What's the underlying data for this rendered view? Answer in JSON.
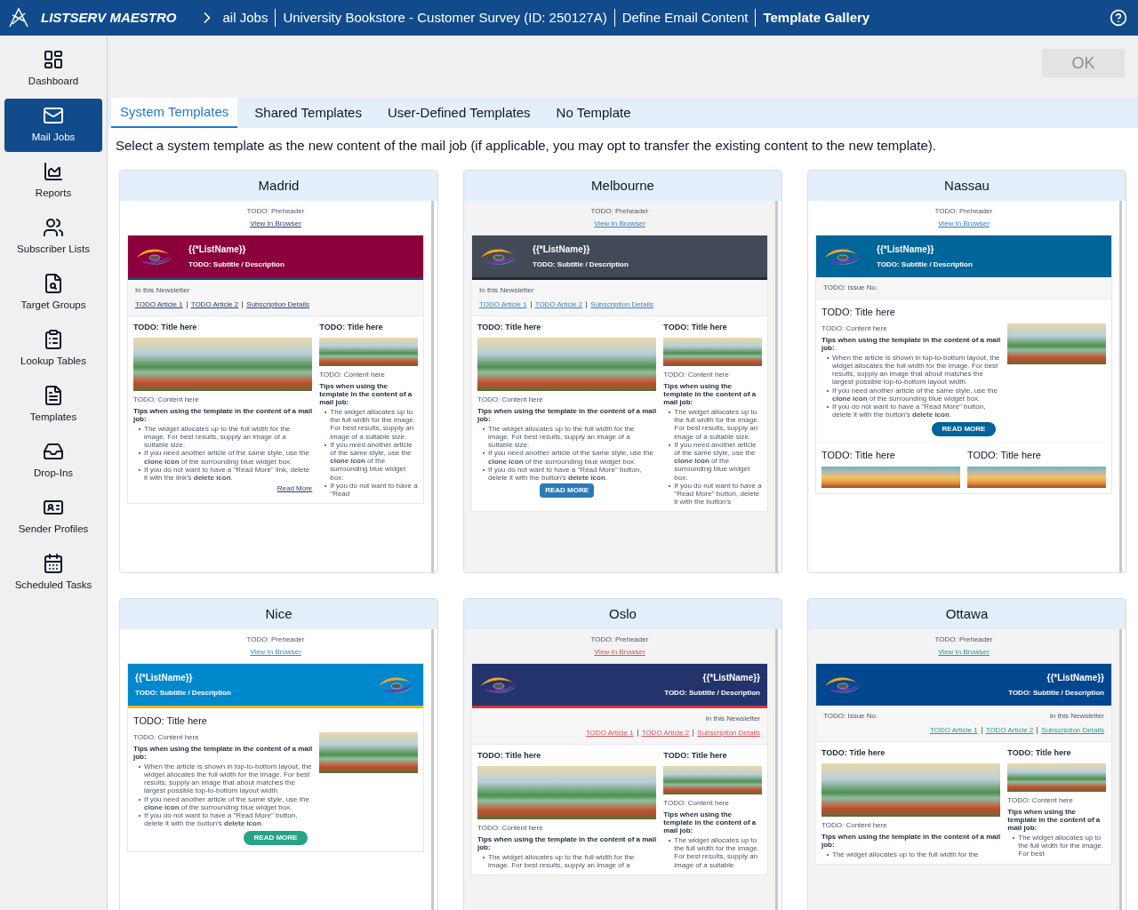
{
  "app": {
    "title": "LISTSERV MAESTRO"
  },
  "breadcrumb": [
    {
      "label": "ail Jobs",
      "current": false
    },
    {
      "label": "University Bookstore - Customer Survey (ID: 250127A)",
      "current": false
    },
    {
      "label": "Define Email Content",
      "current": false
    },
    {
      "label": "Template Gallery",
      "current": true
    }
  ],
  "sidebar": {
    "items": [
      {
        "label": "Dashboard",
        "selected": false
      },
      {
        "label": "Mail Jobs",
        "selected": true
      },
      {
        "label": "Reports",
        "selected": false
      },
      {
        "label": "Subscriber Lists",
        "selected": false
      },
      {
        "label": "Target Groups",
        "selected": false
      },
      {
        "label": "Lookup Tables",
        "selected": false
      },
      {
        "label": "Templates",
        "selected": false
      },
      {
        "label": "Drop-Ins",
        "selected": false
      },
      {
        "label": "Sender Profiles",
        "selected": false
      },
      {
        "label": "Scheduled Tasks",
        "selected": false
      }
    ]
  },
  "ok_button": {
    "label": "OK",
    "disabled": true
  },
  "tabs": [
    {
      "label": "System Templates",
      "selected": true
    },
    {
      "label": "Shared Templates",
      "selected": false
    },
    {
      "label": "User-Defined Templates",
      "selected": false
    },
    {
      "label": "No Template",
      "selected": false
    }
  ],
  "description": "Select a system template as the new content of the mail job (if applicable, you may opt to transfer the existing content to the new template).",
  "templates": [
    {
      "name": "Madrid",
      "preheader": "TODO: Preheader",
      "view_link": "View In Browser",
      "banner": {
        "list_name": "{{*ListName}}",
        "subtitle": "TODO: Subtitle / Description"
      },
      "toc": {
        "heading": "In this Newsletter",
        "links": [
          "TODO Article 1",
          "TODO Article 2",
          "Subscription Details"
        ]
      },
      "sections": [
        {
          "kind": "columns",
          "main": {
            "title": "TODO: Title here",
            "content": "TODO: Content here",
            "tips": "Tips when using the template in the content of a mail job:",
            "bullets": [
              "The widget allocates up to the full width for the image. For best results, supply an image of a suitable size.",
              "If you need another article of the same style, use the **clone icon** of the surrounding blue widget box.",
              "If you do not want to have a \"Read More\" link, delete it with the link's **delete icon**."
            ],
            "action": {
              "kind": "link",
              "label": "Read More"
            }
          },
          "side": {
            "title": "TODO: Title here",
            "content": "TODO: Content here",
            "tips": "Tips when using the template in the content of a mail job:",
            "bullets": [
              "The widget allocates up to the full width for the image. For best results, supply an image of a suitable size.",
              "If you need another article of the same style, use the **clone icon** of the surrounding blue widget box.",
              "If you do not want to have a \"Read"
            ]
          }
        }
      ]
    },
    {
      "name": "Melbourne",
      "preheader": "TODO: Preheader",
      "view_link": "View In Browser",
      "banner": {
        "list_name": "{{*ListName}}",
        "subtitle": "TODO: Subtitle / Description"
      },
      "toc": {
        "heading": "In this Newsletter",
        "links": [
          "TODO Article 1",
          "TODO Article 2",
          "Subscription Details"
        ]
      },
      "sections": [
        {
          "kind": "columns",
          "main": {
            "title": "TODO: Title here",
            "content": "TODO: Content here",
            "tips": "Tips when using the template in the content of a mail job:",
            "bullets": [
              "The widget allocates up to the full width for the image. For best results, supply an image of a suitable size.",
              "If you need another article of the same style, use the **clone icon** of the surrounding blue widget box.",
              "If you do not want to have a \"Read More\" button, delete it with the button's **delete icon**."
            ],
            "action": {
              "kind": "button",
              "label": "READ MORE"
            }
          },
          "side": {
            "title": "TODO: Title here",
            "content": "TODO: Content here",
            "tips": "Tips when using the template in the content of a mail job:",
            "bullets": [
              "The widget allocates up to the full width for the image. For best results, supply an image of a suitable size.",
              "If you need another article of the same style, use the **clone icon** of the surrounding blue widget box.",
              "If you do not want to have a \"Read More\" button, delete it with the button's"
            ]
          }
        }
      ]
    },
    {
      "name": "Nassau",
      "preheader": "TODO: Preheader",
      "view_link": "View In Browser",
      "banner": {
        "list_name": "{{*ListName}}",
        "subtitle": "TODO: Subtitle / Description"
      },
      "toc": {
        "issue": "TODO: Issue No."
      },
      "sections": [
        {
          "kind": "feature",
          "article": {
            "title": "TODO: Title here",
            "content": "TODO: Content here",
            "tips": "Tips when using the template in the content of a mail job:",
            "bullets": [
              "When the article is shown in top-to-bottom layout, the widget allocates the full width for the image. For best results, supply an image that about matches the largest possible top-to-bottom layout width.",
              "If you need another article of the same style, use the **clone icon** of the surrounding blue widget box.",
              "If you do not want to have a \"Read More\" button, delete it with the button's **delete icon**."
            ],
            "action": {
              "kind": "pill",
              "label": "READ MORE"
            }
          }
        },
        {
          "kind": "pair",
          "titles": [
            "TODO: Title here",
            "TODO: Title here"
          ]
        }
      ]
    },
    {
      "name": "Nice",
      "preheader": "TODO: Preheader",
      "view_link": "View In Browser",
      "banner": {
        "list_name": "{{*ListName}}",
        "subtitle": "TODO: Subtitle / Description"
      },
      "sections": [
        {
          "kind": "feature",
          "article": {
            "title": "TODO: Title here",
            "content": "TODO: Content here",
            "tips": "Tips when using the template in the content of a mail job:",
            "bullets": [
              "When the article is shown in top-to-bottom layout, the widget allocates the full width for the image. For best results, supply an image that about matches the largest possible top-to-bottom layout width.",
              "If you need another article of the same style, use the **clone icon** of the surrounding blue widget box.",
              "If you do not want to have a \"Read More\" button, delete it with the button's **delete icon**."
            ],
            "action": {
              "kind": "pill",
              "label": "READ MORE"
            }
          }
        }
      ]
    },
    {
      "name": "Oslo",
      "preheader": "TODO: Preheader",
      "view_link": "View In Browser",
      "banner": {
        "list_name": "{{*ListName}}",
        "subtitle": "TODO: Subtitle / Description"
      },
      "toc": {
        "heading": "In this Newsletter",
        "links": [
          "TODO Article 1",
          "TODO Article 2",
          "Subscription Details"
        ]
      },
      "sections": [
        {
          "kind": "columns",
          "main": {
            "title": "TODO: Title here",
            "content": "TODO: Content here",
            "tips": "Tips when using the template in the content of a mail job:",
            "bullets": [
              "The widget allocates up to the full width for the image. For best results, supply an image of a"
            ]
          },
          "side": {
            "title": "TODO: Title here",
            "content": "TODO: Content here",
            "tips": "Tips when using the template in the content of a mail job:",
            "bullets": [
              "The widget allocates up to the full width for the image. For best results, supply an image of a suitable"
            ]
          }
        }
      ]
    },
    {
      "name": "Ottawa",
      "preheader": "TODO: Preheader",
      "view_link": "View In Browser",
      "banner": {
        "list_name": "{{*ListName}}",
        "subtitle": "TODO: Subtitle / Description"
      },
      "toc": {
        "issue": "TODO: Issue No.",
        "heading": "In this Newsletter",
        "links": [
          "TODO Article 1",
          "TODO Article 2",
          "Subscription Details"
        ]
      },
      "sections": [
        {
          "kind": "columns",
          "main": {
            "title": "TODO: Title here",
            "content": "TODO: Content here",
            "tips": "Tips when using the template in the content of a mail job:",
            "bullets": [
              "The widget allocates up to the full width for the"
            ]
          },
          "side": {
            "title": "TODO: Title here",
            "content": "TODO: Content here",
            "tips": "Tips when using the template in the content of a mail job:",
            "bullets": [
              "The widget allocates up to the full width for the image. For best"
            ]
          }
        }
      ]
    }
  ]
}
